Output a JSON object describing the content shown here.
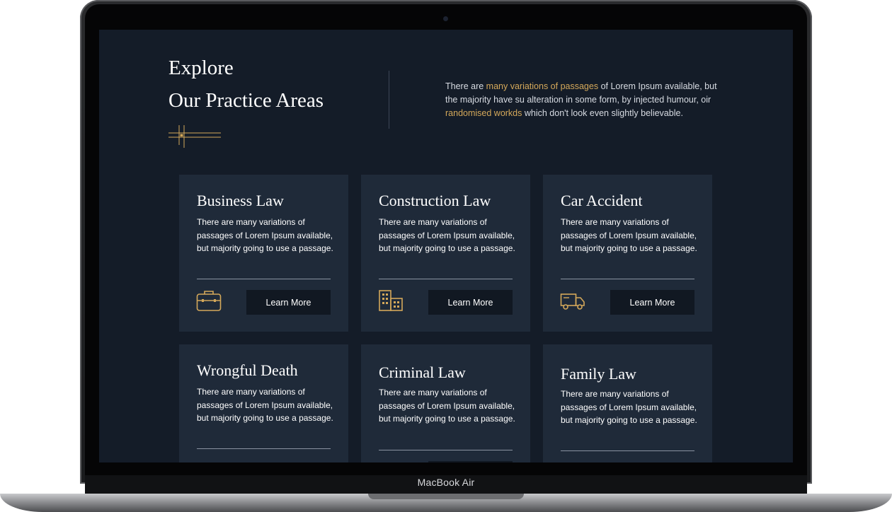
{
  "device": {
    "brand_label": "MacBook Air"
  },
  "section": {
    "title_line1": "Explore",
    "title_line2": "Our Practice Areas",
    "intro": {
      "part1": "There are ",
      "highlight1": "many variations of passages",
      "part2": " of Lorem Ipsum available, but the majority have su alteration in some form, by injected humour, oir ",
      "highlight2": "randomised workds",
      "part3": " which don't look even slightly believable."
    }
  },
  "colors": {
    "accent": "#d4a85a",
    "page_background": "#141c28",
    "card_background": "#1f2a39",
    "button_background": "#111822"
  },
  "cards": [
    {
      "title": "Business Law",
      "text": "There are many variations of passages of Lorem Ipsum available, but majority going to use a passage.",
      "icon": "briefcase-icon",
      "button": "Learn More"
    },
    {
      "title": "Construction Law",
      "text": "There are many variations of passages of Lorem Ipsum available, but majority going to use a passage.",
      "icon": "building-icon",
      "button": "Learn More"
    },
    {
      "title": "Car Accident",
      "text": "There are many variations of passages of Lorem Ipsum available, but majority going to use a passage.",
      "icon": "truck-icon",
      "button": "Learn More"
    },
    {
      "title": "Wrongful Death",
      "text": "There are many variations of passages of Lorem Ipsum available, but majority going to use a passage."
    },
    {
      "title": "Criminal Law",
      "text": "There are many variations of passages of Lorem Ipsum available, but majority going to use a passage."
    },
    {
      "title": "Family Law",
      "text": "There are many variations of passages of Lorem Ipsum available, but majority going to use a passage."
    }
  ]
}
